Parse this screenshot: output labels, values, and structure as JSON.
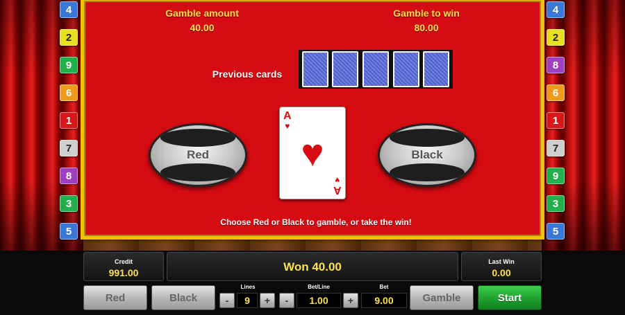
{
  "gamble": {
    "gamble_amount_label": "Gamble amount",
    "gamble_amount_value": "40.00",
    "gamble_to_win_label": "Gamble to win",
    "gamble_to_win_value": "80.00",
    "previous_cards_label": "Previous cards",
    "previous_cards_count": 5,
    "red_button_label": "Red",
    "black_button_label": "Black",
    "instruction": "Choose Red or Black to gamble, or take the win!",
    "current_card": {
      "rank": "A",
      "suit": "♥",
      "suit_name": "hearts",
      "color": "#d80c12"
    }
  },
  "line_numbers": {
    "left": [
      {
        "num": "4",
        "color": "#3a78d8"
      },
      {
        "num": "2",
        "color": "#e8e020"
      },
      {
        "num": "9",
        "color": "#22b04a"
      },
      {
        "num": "6",
        "color": "#f29a1a"
      },
      {
        "num": "1",
        "color": "#d81818"
      },
      {
        "num": "7",
        "color": "#cfcfcf"
      },
      {
        "num": "8",
        "color": "#a040c0"
      },
      {
        "num": "3",
        "color": "#22b04a"
      },
      {
        "num": "5",
        "color": "#3a78d8"
      }
    ],
    "right": [
      {
        "num": "4",
        "color": "#3a78d8"
      },
      {
        "num": "2",
        "color": "#e8e020"
      },
      {
        "num": "8",
        "color": "#a040c0"
      },
      {
        "num": "6",
        "color": "#f29a1a"
      },
      {
        "num": "1",
        "color": "#d81818"
      },
      {
        "num": "7",
        "color": "#cfcfcf"
      },
      {
        "num": "9",
        "color": "#22b04a"
      },
      {
        "num": "3",
        "color": "#22b04a"
      },
      {
        "num": "5",
        "color": "#3a78d8"
      }
    ]
  },
  "controls": {
    "credit_label": "Credit",
    "credit_value": "991.00",
    "message": "Won 40.00",
    "last_win_label": "Last Win",
    "last_win_value": "0.00",
    "red_label": "Red",
    "black_label": "Black",
    "lines_label": "Lines",
    "lines_value": "9",
    "betline_label": "Bet/Line",
    "betline_value": "1.00",
    "bet_label": "Bet",
    "bet_value": "9.00",
    "gamble_label": "Gamble",
    "start_label": "Start",
    "minus_symbol": "-",
    "plus_symbol": "+"
  },
  "colors": {
    "panel_red": "#d80c12",
    "panel_border": "#f2c200",
    "yellow_text": "#ffe14a",
    "start_green": "#1ea030"
  }
}
